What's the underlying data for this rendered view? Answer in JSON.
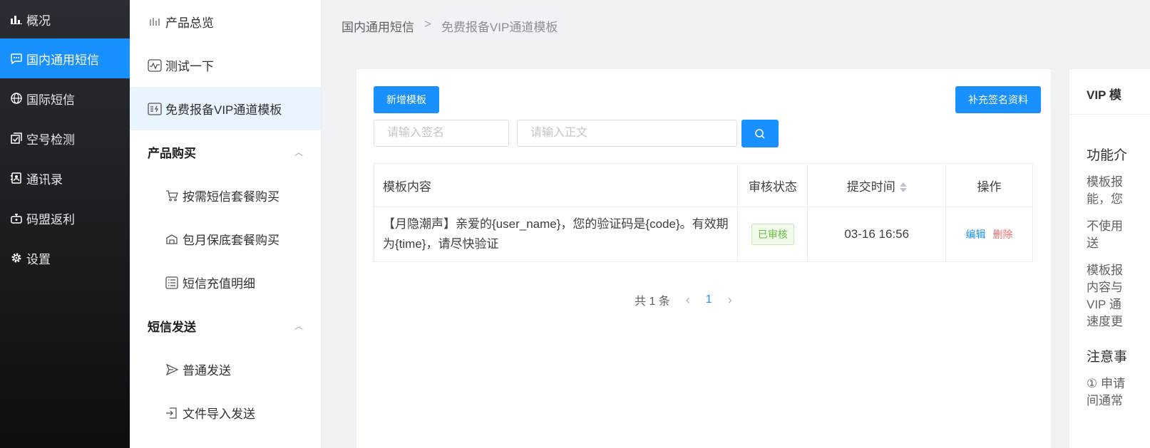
{
  "sidebar": {
    "items": [
      {
        "label": "概况",
        "icon": "bar-chart-icon"
      },
      {
        "label": "国内通用短信",
        "icon": "message-icon",
        "active": true
      },
      {
        "label": "国际短信",
        "icon": "globe-icon"
      },
      {
        "label": "空号检测",
        "icon": "check-icon"
      },
      {
        "label": "通讯录",
        "icon": "contacts-icon"
      },
      {
        "label": "码盟返利",
        "icon": "rebate-icon"
      },
      {
        "label": "设置",
        "icon": "gear-icon"
      }
    ]
  },
  "submenu": {
    "overview": "产品总览",
    "test": "测试一下",
    "vip": "免费报备VIP通道模板",
    "group_buy": "产品购买",
    "buy_items": [
      "按需短信套餐购买",
      "包月保底套餐购买",
      "短信充值明细"
    ],
    "group_send": "短信发送",
    "send_items": [
      "普通发送",
      "文件导入发送"
    ]
  },
  "breadcrumb": {
    "parent": "国内通用短信",
    "separator": ">",
    "current": "免费报备VIP通道模板"
  },
  "toolbar": {
    "add_label": "新增模板",
    "supplement_label": "补充签名资料"
  },
  "search": {
    "sign_placeholder": "请输入签名",
    "content_placeholder": "请输入正文"
  },
  "table": {
    "headers": {
      "content": "模板内容",
      "status": "审核状态",
      "time": "提交时间",
      "ops": "操作"
    },
    "rows": [
      {
        "content": "【月隐潮声】亲爱的{user_name}，您的验证码是{code}。有效期为{time}，请尽快验证",
        "status": "已审核",
        "time": "03-16 16:56",
        "edit": "编辑",
        "delete": "删除"
      }
    ]
  },
  "pagination": {
    "total": "共 1 条",
    "page": "1"
  },
  "right_panel": {
    "title": "VIP 模",
    "section1": "功能介",
    "p1_l1": "模板报",
    "p1_l2": "能，您",
    "p2_l1": "不使用",
    "p2_l2": "送",
    "p3_l1": "模板报",
    "p3_l2": "内容与",
    "p3_l3": "VIP 通",
    "p3_l4": "速度更",
    "section2": "注意事",
    "p4_l1": "① 申请",
    "p4_l2": "间通常"
  },
  "colors": {
    "primary": "#1890ff",
    "danger": "#f56c6c",
    "success": "#67c23a"
  }
}
